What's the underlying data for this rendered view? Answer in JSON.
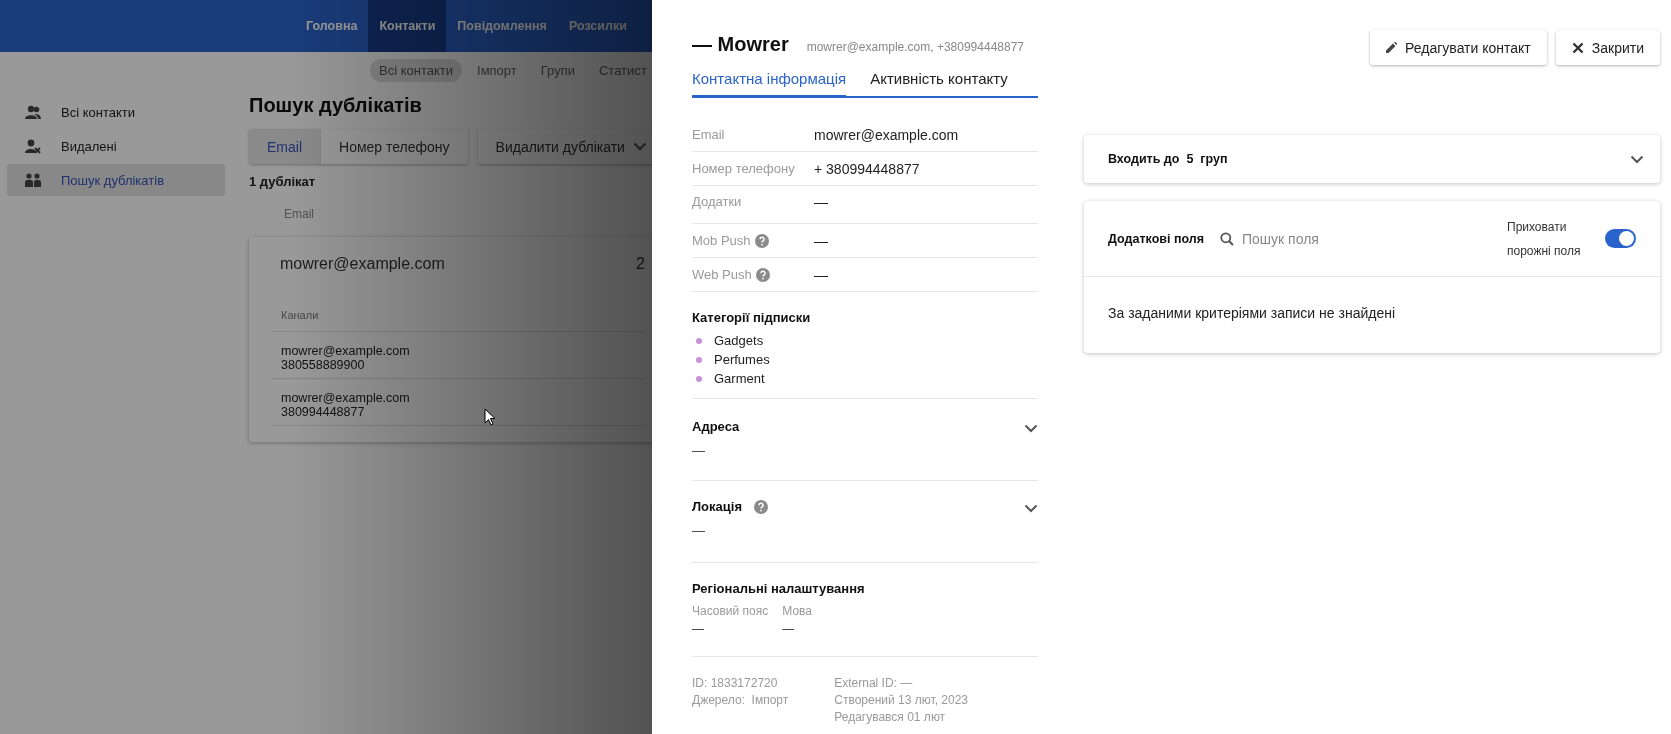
{
  "topnav": {
    "items": [
      {
        "label": "Головна",
        "selected": false
      },
      {
        "label": "Контакти",
        "selected": true
      },
      {
        "label": "Повідомлення",
        "selected": false
      },
      {
        "label": "Розсилки",
        "selected": false
      }
    ]
  },
  "subnav": {
    "items": [
      {
        "label": "Всі контакти",
        "selected": true
      },
      {
        "label": "Імпорт",
        "selected": false
      },
      {
        "label": "Групи",
        "selected": false
      },
      {
        "label": "Статист",
        "selected": false
      }
    ]
  },
  "sidebar": {
    "items": [
      {
        "label": "Всі контакти",
        "selected": false
      },
      {
        "label": "Видалені",
        "selected": false
      },
      {
        "label": "Пошук дублікатів",
        "selected": true
      }
    ]
  },
  "main": {
    "title": "Пошук дублікатів",
    "filter_tabs": [
      {
        "label": "Email",
        "selected": true
      },
      {
        "label": "Номер телефону",
        "selected": false
      }
    ],
    "action_button": "Видалити дублікати",
    "count": "1 дублікат",
    "column_header": "Email",
    "group": {
      "email": "mowrer@example.com",
      "column_2": "2",
      "channels_header": "Канали",
      "rows": [
        {
          "email": "mowrer@example.com",
          "phone": "380558889900"
        },
        {
          "email": "mowrer@example.com",
          "phone": "380994448877"
        }
      ]
    }
  },
  "panel": {
    "name": "— Mowrer",
    "subtitle": "mowrer@example.com, +380994448877",
    "buttons": [
      {
        "kind": "edit",
        "label": "Редагувати контакт"
      },
      {
        "kind": "close",
        "label": "Закрити"
      }
    ],
    "tabs": [
      {
        "label": "Контактна інформація",
        "selected": true
      },
      {
        "label": "Активність контакту",
        "selected": false
      }
    ],
    "fields": [
      {
        "label": "Email",
        "value": "mowrer@example.com",
        "help": false
      },
      {
        "label": "Номер телефону",
        "value": "+ 380994448877",
        "help": false
      },
      {
        "label": "Додатки",
        "value": "—",
        "help": false
      },
      {
        "label": "Mob Push",
        "value": "—",
        "help": true
      },
      {
        "label": "Web Push",
        "value": "—",
        "help": true
      }
    ],
    "categories": {
      "title": "Категорії підписки",
      "items": [
        "Gadgets",
        "Perfumes",
        "Garment"
      ]
    },
    "sections": [
      {
        "title": "Адреса",
        "value": "—",
        "help": false,
        "expanded": false
      },
      {
        "title": "Локація",
        "value": "—",
        "help": true,
        "expanded": false
      }
    ],
    "regional": {
      "title": "Регіональні налаштування",
      "fields": [
        {
          "label": "Часовий пояс",
          "value": "—"
        },
        {
          "label": "Мова",
          "value": "—"
        }
      ]
    },
    "footer": {
      "column_1": [
        "ID: 1833172720",
        "Джерело:  Імпорт"
      ],
      "column_2": [
        "External ID: —",
        "Створений 13 лют, 2023",
        "Редагувався 01 лют"
      ]
    },
    "groups_card": {
      "title": "Входить до  5  груп",
      "expanded": false
    },
    "extra_fields": {
      "title": "Додаткові поля",
      "search": {
        "placeholder": "Пошук поля"
      },
      "hide_empty": {
        "label": "Приховати порожні поля",
        "on": true
      },
      "empty_message": "За заданими критеріями записи не знайдені"
    }
  }
}
